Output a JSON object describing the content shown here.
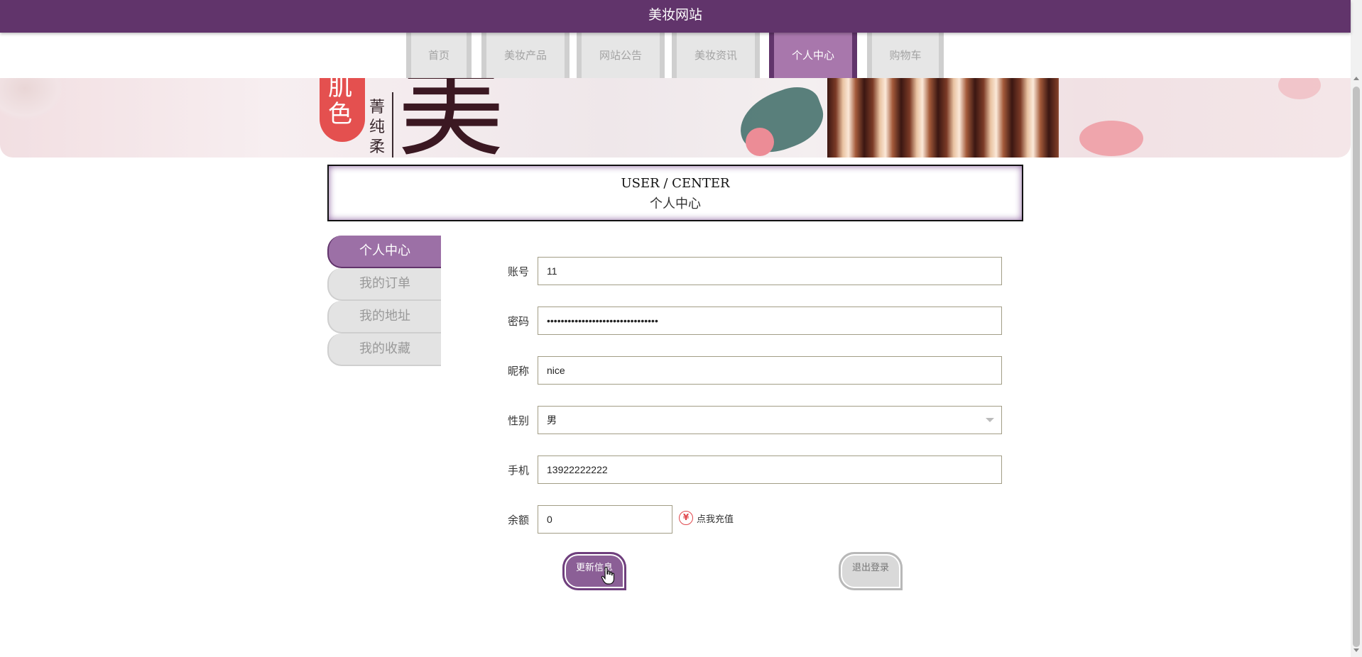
{
  "site": {
    "title": "美妆网站"
  },
  "nav": {
    "items": [
      {
        "label": "首页",
        "active": false
      },
      {
        "label": "美妆产品",
        "active": false
      },
      {
        "label": "网站公告",
        "active": false
      },
      {
        "label": "美妆资讯",
        "active": false
      },
      {
        "label": "个人中心",
        "active": true
      },
      {
        "label": "购物车",
        "active": false
      }
    ]
  },
  "banner": {
    "text_large": "美",
    "text_side": [
      "菁",
      "纯",
      "柔"
    ],
    "text_badge": [
      "肌",
      "色"
    ]
  },
  "center": {
    "title_en": "USER / CENTER",
    "title_cn": "个人中心"
  },
  "sidebar": {
    "items": [
      {
        "label": "个人中心",
        "active": true
      },
      {
        "label": "我的订单",
        "active": false
      },
      {
        "label": "我的地址",
        "active": false
      },
      {
        "label": "我的收藏",
        "active": false
      }
    ]
  },
  "form": {
    "account": {
      "label": "账号",
      "value": "11"
    },
    "password": {
      "label": "密码",
      "value": "11111111111111111111111111111111"
    },
    "nickname": {
      "label": "昵称",
      "value": "nice"
    },
    "gender": {
      "label": "性别",
      "value": "男"
    },
    "phone": {
      "label": "手机",
      "value": "13922222222"
    },
    "balance": {
      "label": "余额",
      "value": "0",
      "recharge_label": "点我充值"
    }
  },
  "buttons": {
    "update_label": "更新信息",
    "logout_label": "退出登录"
  },
  "colors": {
    "brand": "#61346b",
    "accent": "#a877ac",
    "inactive": "#e6e6e6"
  }
}
